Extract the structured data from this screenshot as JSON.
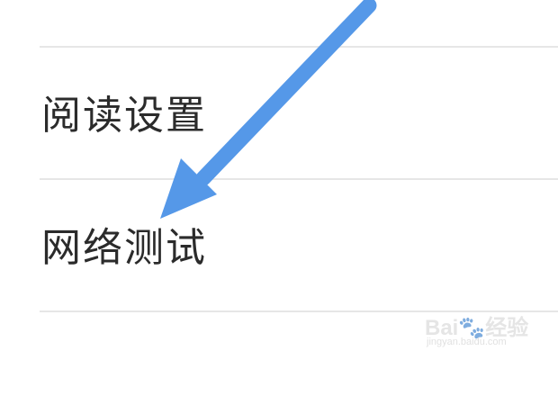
{
  "settings": {
    "items": [
      {
        "label": ""
      },
      {
        "label": "阅读设置"
      },
      {
        "label": "网络测试"
      },
      {
        "label": ""
      }
    ]
  },
  "annotation": {
    "arrow_color": "#5598e8"
  },
  "watermark": {
    "brand": "Bai🐾经验",
    "url": "jingyan.baidu.com"
  }
}
